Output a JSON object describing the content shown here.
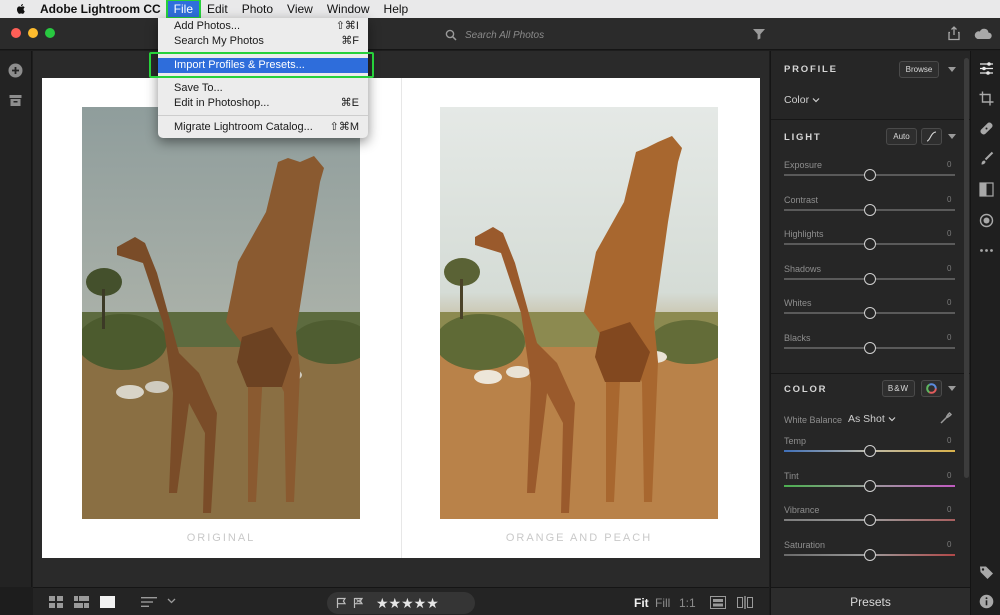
{
  "menubar": {
    "app_name": "Adobe Lightroom CC",
    "items": [
      "File",
      "Edit",
      "Photo",
      "View",
      "Window",
      "Help"
    ],
    "active": "File"
  },
  "file_menu": {
    "items": [
      {
        "label": "Add Photos...",
        "shortcut": "⇧⌘I"
      },
      {
        "label": "Search My Photos",
        "shortcut": "⌘F"
      },
      {
        "label": "Import Profiles & Presets...",
        "shortcut": ""
      },
      {
        "label": "Save To...",
        "shortcut": ""
      },
      {
        "label": "Edit in Photoshop...",
        "shortcut": "⌘E"
      },
      {
        "label": "Migrate Lightroom Catalog...",
        "shortcut": "⇧⌘M"
      }
    ],
    "highlighted": "Import Profiles & Presets..."
  },
  "toolbar": {
    "search_placeholder": "Search All Photos"
  },
  "canvas": {
    "left_caption": "ORIGINAL",
    "right_caption": "ORANGE AND PEACH"
  },
  "bottombar": {
    "stars": "★★★★★",
    "zoom_options": [
      "Fit",
      "Fill",
      "1:1"
    ],
    "zoom_selected": "Fit"
  },
  "panel": {
    "profile": {
      "title": "PROFILE",
      "browse_label": "Browse",
      "profile_value": "Color"
    },
    "light": {
      "title": "LIGHT",
      "auto_label": "Auto",
      "sliders": [
        {
          "label": "Exposure",
          "value": "0",
          "level": 0.5
        },
        {
          "label": "Contrast",
          "value": "0",
          "level": 0.5
        },
        {
          "label": "Highlights",
          "value": "0",
          "level": 0.5
        },
        {
          "label": "Shadows",
          "value": "0",
          "level": 0.5
        },
        {
          "label": "Whites",
          "value": "0",
          "level": 0.5
        },
        {
          "label": "Blacks",
          "value": "0",
          "level": 0.5
        }
      ]
    },
    "color": {
      "title": "COLOR",
      "bw_label": "B&W",
      "white_balance_label": "White Balance",
      "white_balance_value": "As Shot",
      "sliders": [
        {
          "label": "Temp",
          "value": "0",
          "level": 0.5
        },
        {
          "label": "Tint",
          "value": "0",
          "level": 0.5
        },
        {
          "label": "Vibrance",
          "value": "0",
          "level": 0.5
        },
        {
          "label": "Saturation",
          "value": "0",
          "level": 0.5
        }
      ]
    },
    "presets_label": "Presets"
  },
  "colors": {
    "menu_highlight": "#2e6ddb",
    "callout_green": "#27d13b",
    "traffic_red": "#fe5f57",
    "traffic_yellow": "#febc2e",
    "traffic_green": "#28c840"
  }
}
